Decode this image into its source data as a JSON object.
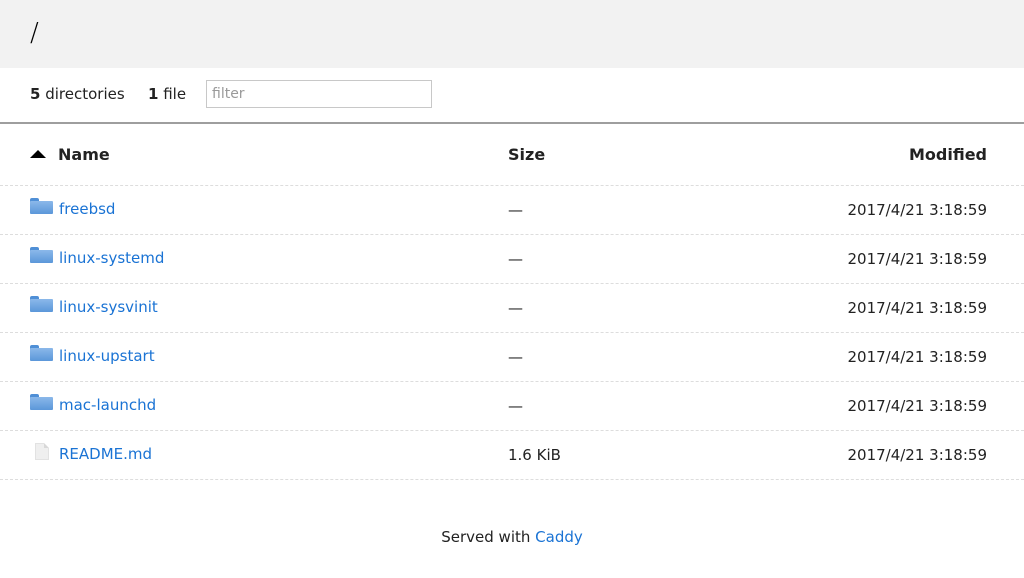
{
  "header": {
    "path": "/"
  },
  "summary": {
    "directories_count": "5",
    "directories_label": "directories",
    "files_count": "1",
    "files_label": "file"
  },
  "filter": {
    "placeholder": "filter",
    "value": ""
  },
  "table": {
    "columns": {
      "name": "Name",
      "size": "Size",
      "modified": "Modified"
    },
    "sort": {
      "column": "name",
      "direction": "ascending"
    },
    "rows": [
      {
        "type": "folder",
        "name": "freebsd",
        "size": "—",
        "modified": "2017/4/21 3:18:59"
      },
      {
        "type": "folder",
        "name": "linux-systemd",
        "size": "—",
        "modified": "2017/4/21 3:18:59"
      },
      {
        "type": "folder",
        "name": "linux-sysvinit",
        "size": "—",
        "modified": "2017/4/21 3:18:59"
      },
      {
        "type": "folder",
        "name": "linux-upstart",
        "size": "—",
        "modified": "2017/4/21 3:18:59"
      },
      {
        "type": "folder",
        "name": "mac-launchd",
        "size": "—",
        "modified": "2017/4/21 3:18:59"
      },
      {
        "type": "file",
        "name": "README.md",
        "size": "1.6 KiB",
        "modified": "2017/4/21 3:18:59"
      }
    ]
  },
  "footer": {
    "prefix": "Served with",
    "link_text": "Caddy"
  },
  "colors": {
    "link": "#1a73d4",
    "header_bg": "#f2f2f2",
    "folder": "#5b97d9"
  },
  "icons": {
    "folder": "folder-icon",
    "file": "file-icon",
    "sort": "sort-ascending-icon"
  }
}
